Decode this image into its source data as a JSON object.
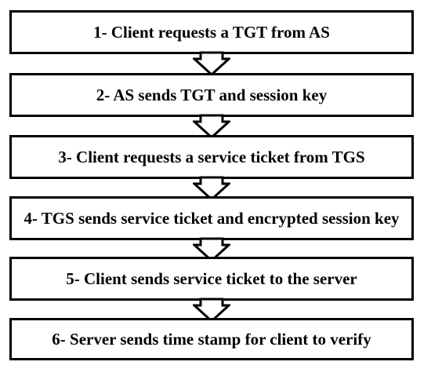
{
  "steps": [
    {
      "number": "1",
      "text": "1- Client requests a TGT from AS"
    },
    {
      "number": "2",
      "text": "2- AS sends TGT and session key"
    },
    {
      "number": "3",
      "text": "3- Client requests a service ticket from TGS"
    },
    {
      "number": "4",
      "text": "4- TGS sends service ticket and encrypted session key"
    },
    {
      "number": "5",
      "text": "5- Client sends service ticket to the server"
    },
    {
      "number": "6",
      "text": "6- Server sends time stamp for client to verify"
    }
  ],
  "colors": {
    "border": "#000000",
    "background": "#ffffff",
    "text": "#000000"
  }
}
